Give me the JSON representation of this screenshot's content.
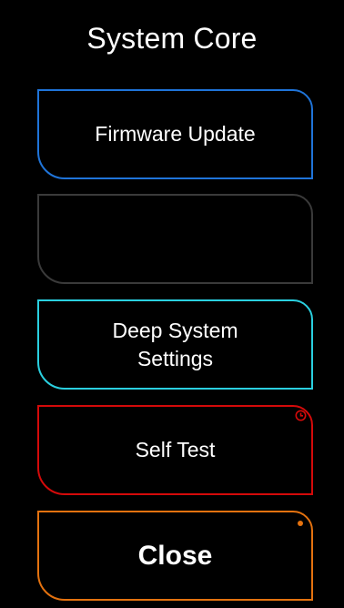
{
  "header": {
    "title": "System Core"
  },
  "menu": {
    "firmware_update": "Firmware Update",
    "empty_slot": "",
    "deep_settings": "Deep System\nSettings",
    "self_test": "Self Test",
    "close": "Close"
  },
  "icons": {
    "self_test_indicator": "clock-icon",
    "close_indicator": "dot-icon"
  },
  "colors": {
    "background": "#000000",
    "text": "#ffffff",
    "firmware_border": "#1f74d9",
    "empty_border": "#3a3a3a",
    "deep_border": "#2ad0e0",
    "self_test_border": "#d40a0a",
    "close_border": "#e4720f"
  }
}
